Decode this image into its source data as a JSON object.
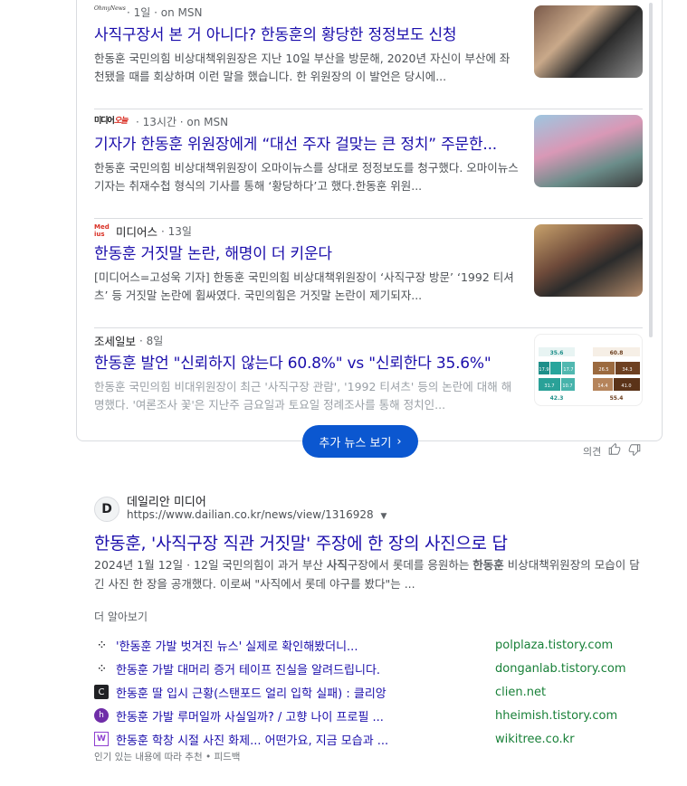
{
  "news": [
    {
      "source_logo": "OhmyNews",
      "source_name": "",
      "meta": "· 1일 · on MSN",
      "title": "사직구장서 본 거 아니다? 한동훈의 황당한 정정보도 신청",
      "snippet": "한동훈 국민의힘 비상대책위원장은 지난 10일 부산을 방문해, 2020년 자신이 부산에 좌천됐을 때를 회상하며 이런 말을 했습니다. 한 위원장의 이 발언은 당시에...",
      "thumb": "thumb1"
    },
    {
      "source_logo": "미디어오늘",
      "source_name": "",
      "meta": "· 13시간 · on MSN",
      "title": "기자가 한동훈 위원장에게 “대선 주자 걸맞는 큰 정치” 주문한...",
      "snippet": "한동훈 국민의힘 비상대책위원장이 오마이뉴스를 상대로 정정보도를 청구했다. 오마이뉴스 기자는 취재수첩 형식의 기사를 통해 ‘황당하다’고 했다.한동훈 위원...",
      "thumb": "thumb2"
    },
    {
      "source_logo": "Medius",
      "source_name": "미디어스",
      "meta": "· 13일",
      "title": "한동훈 거짓말 논란, 해명이 더 키운다",
      "snippet": "[미디어스=고성욱 기자] 한동훈 국민의힘 비상대책위원장이 ‘사직구장 방문’ ‘1992 티셔츠’ 등 거짓말 논란에 휩싸였다. 국민의힘은 거짓말 논란이 제기되자...",
      "thumb": "thumb3"
    },
    {
      "source_logo": "",
      "source_name": "조세일보",
      "meta": "· 8일",
      "title": "한동훈 발언 \"신뢰하지 않는다 60.8%\" vs \"신뢰한다 35.6%\"",
      "snippet": "한동훈 국민의힘 비대위원장이 최근 '사직구장 관람', '1992 티셔츠' 등의 논란에 대해 해명했다. '여론조사 꽃'은 지난주 금요일과 토요일 정례조사를 통해 정치인...",
      "thumb": "thumb4"
    }
  ],
  "thumb4_values": [
    "35.6",
    "60.8",
    "17.9",
    "17.7",
    "26.5",
    "34.3",
    "31.7",
    "10.7",
    "14.4",
    "41.0",
    "42.3",
    "55.4"
  ],
  "more_news_button": "추가 뉴스 보기",
  "feedback_label": "의견",
  "result": {
    "site_icon_letter": "D",
    "site_name": "데일리안 미디어",
    "url": "https://www.dailian.co.kr/news/view/1316928",
    "title": "한동훈, '사직구장 직관 거짓말' 주장에 한 장의 사진으로 답",
    "date": "2024년 1월 12일",
    "snippet_a": " · 12일 국민의힘이 과거 부산 ",
    "snippet_bold1": "사직",
    "snippet_b": "구장에서 롯데를 응원하는 ",
    "snippet_bold2": "한동훈",
    "snippet_c": " 비상대책위원장의 모습이 담긴 사진 한 장을 공개했다. 이로써 \"사직에서 롯데 야구를 봤다\"는 ..."
  },
  "more_label": "더 알아보기",
  "related": [
    {
      "icon": "dots",
      "icon_glyph": "⁘",
      "text": "'한동훈 가발 벗겨진 뉴스' 실제로 확인해봤더니...",
      "domain": "polplaza.tistory.com"
    },
    {
      "icon": "dots",
      "icon_glyph": "⁘",
      "text": "한동훈 가발 대머리 증거 테이프 진실을 알려드립니다.",
      "domain": "donganlab.tistory.com"
    },
    {
      "icon": "clien",
      "icon_glyph": "C",
      "text": "한동훈 딸 입시 근황(스탠포드 얼리 입학 실패) : 클리앙",
      "domain": "clien.net"
    },
    {
      "icon": "hhe",
      "icon_glyph": "h",
      "text": "한동훈 가발 루머일까 사실일까? / 고향 나이 프로필 ...",
      "domain": "hheimish.tistory.com"
    },
    {
      "icon": "wiki",
      "icon_glyph": "W",
      "text": "한동훈 학창 시절 사진 화제... 어떤가요, 지금 모습과 ...",
      "domain": "wikitree.co.kr"
    }
  ],
  "footnote": "인기 있는 내용에 따라 추천 • 피드백"
}
